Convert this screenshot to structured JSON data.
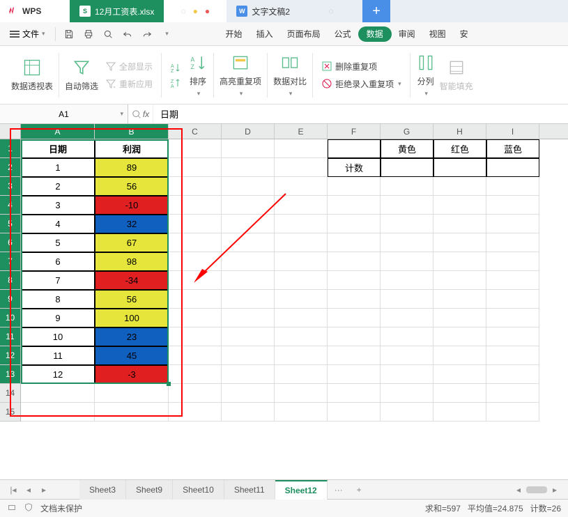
{
  "app": {
    "name": "WPS"
  },
  "docTabs": {
    "spreadsheet": {
      "icon": "S",
      "label": "12月工资表.xlsx"
    },
    "word": {
      "icon": "W",
      "label": "文字文稿2"
    }
  },
  "menu": {
    "file": "文件",
    "tabs": {
      "start": "开始",
      "insert": "插入",
      "layout": "页面布局",
      "formula": "公式",
      "data": "数据",
      "review": "审阅",
      "view": "视图",
      "safe": "安"
    }
  },
  "ribbon": {
    "pivot": "数据透视表",
    "autofilter": "自动筛选",
    "showall": "全部显示",
    "reapply": "重新应用",
    "sort": "排序",
    "highlight_dup": "高亮重复项",
    "compare": "数据对比",
    "remove_dup": "删除重复项",
    "reject_dup": "拒绝录入重复项",
    "text_to_cols": "分列",
    "smart_fill": "智能填充"
  },
  "formula": {
    "namebox": "A1",
    "fx": "fx",
    "value": "日期"
  },
  "columns": [
    "A",
    "B",
    "C",
    "D",
    "E",
    "F",
    "G",
    "H",
    "I"
  ],
  "rownums": [
    "1",
    "2",
    "3",
    "4",
    "5",
    "6",
    "7",
    "8",
    "9",
    "10",
    "11",
    "12",
    "13",
    "14",
    "15"
  ],
  "table": {
    "headers": {
      "a": "日期",
      "b": "利润"
    },
    "rows": [
      {
        "d": "1",
        "v": "89",
        "c": "yellow"
      },
      {
        "d": "2",
        "v": "56",
        "c": "yellow"
      },
      {
        "d": "3",
        "v": "-10",
        "c": "red"
      },
      {
        "d": "4",
        "v": "32",
        "c": "blue"
      },
      {
        "d": "5",
        "v": "67",
        "c": "yellow"
      },
      {
        "d": "6",
        "v": "98",
        "c": "yellow"
      },
      {
        "d": "7",
        "v": "-34",
        "c": "red"
      },
      {
        "d": "8",
        "v": "56",
        "c": "yellow"
      },
      {
        "d": "9",
        "v": "100",
        "c": "yellow"
      },
      {
        "d": "10",
        "v": "23",
        "c": "blue"
      },
      {
        "d": "11",
        "v": "45",
        "c": "blue"
      },
      {
        "d": "12",
        "v": "-3",
        "c": "red"
      }
    ]
  },
  "side_table": {
    "g1": "黄色",
    "h1": "红色",
    "i1": "蓝色",
    "f2": "计数"
  },
  "sheets": {
    "s3": "Sheet3",
    "s9": "Sheet9",
    "s10": "Sheet10",
    "s11": "Sheet11",
    "s12": "Sheet12",
    "more": "···",
    "add": "+"
  },
  "status": {
    "protect": "文档未保护",
    "sum": "求和=597",
    "avg": "平均值=24.875",
    "count": "计数=26"
  },
  "chart_data": {
    "type": "table",
    "title": "利润 by 日期",
    "columns": [
      "日期",
      "利润",
      "color"
    ],
    "rows": [
      [
        1,
        89,
        "yellow"
      ],
      [
        2,
        56,
        "yellow"
      ],
      [
        3,
        -10,
        "red"
      ],
      [
        4,
        32,
        "blue"
      ],
      [
        5,
        67,
        "yellow"
      ],
      [
        6,
        98,
        "yellow"
      ],
      [
        7,
        -34,
        "red"
      ],
      [
        8,
        56,
        "yellow"
      ],
      [
        9,
        100,
        "yellow"
      ],
      [
        10,
        23,
        "blue"
      ],
      [
        11,
        45,
        "blue"
      ],
      [
        12,
        -3,
        "red"
      ]
    ],
    "aggregate": {
      "sum": 597,
      "avg": 24.875,
      "count": 26
    },
    "legend": {
      "黄色": "yellow",
      "红色": "red",
      "蓝色": "blue"
    }
  }
}
